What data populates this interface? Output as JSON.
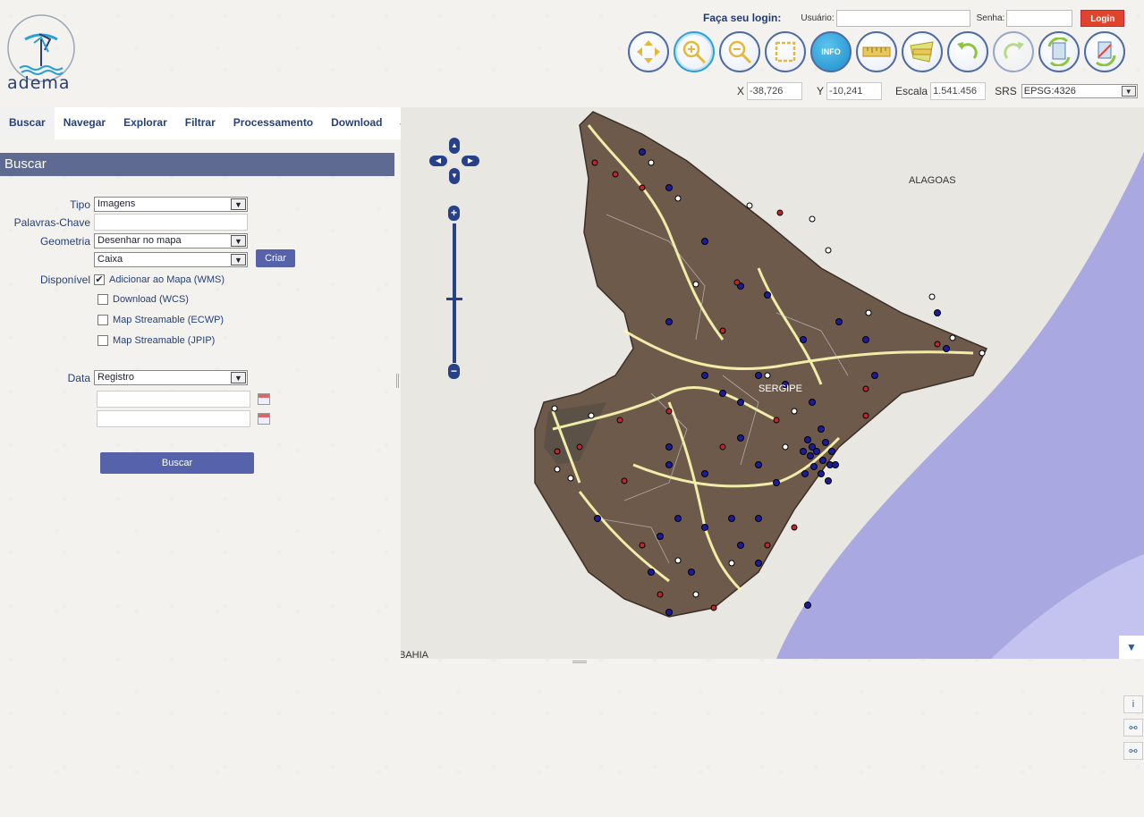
{
  "app": {
    "logo_text": "adema"
  },
  "login": {
    "title": "Faça seu login:",
    "user_label": "Usuário:",
    "password_label": "Senha:",
    "button": "Login"
  },
  "toolbar": {
    "tools": [
      "pan-icon",
      "zoom-in-icon",
      "zoom-out-icon",
      "zoom-box-icon",
      "info-icon",
      "measure-distance-icon",
      "measure-area-icon",
      "undo-icon",
      "redo-icon",
      "refresh-icon",
      "clear-icon"
    ],
    "info_label": "INFO"
  },
  "coords": {
    "x_label": "X",
    "x_value": "-38,726",
    "y_label": "Y",
    "y_value": "-10,241",
    "scale_label": "Escala",
    "scale_value": "1.541.456",
    "srs_label": "SRS",
    "srs_value": "EPSG:4326"
  },
  "tabs": [
    {
      "label": "Buscar"
    },
    {
      "label": "Navegar"
    },
    {
      "label": "Explorar"
    },
    {
      "label": "Filtrar"
    },
    {
      "label": "Processamento"
    },
    {
      "label": "Download"
    }
  ],
  "panel": {
    "title": "Buscar",
    "tipo_label": "Tipo",
    "tipo_value": "Imagens",
    "palavras_label": "Palavras-Chave",
    "geometria_label": "Geometria",
    "geometria_value": "Desenhar no mapa",
    "forma_value": "Caixa",
    "criar_button": "Criar",
    "disponivel_label": "Disponível",
    "options": [
      {
        "label": "Adicionar ao Mapa (WMS)",
        "checked": "✔"
      },
      {
        "label": "Download (WCS)",
        "checked": ""
      },
      {
        "label": "Map Streamable (ECWP)",
        "checked": ""
      },
      {
        "label": "Map Streamable (JPIP)",
        "checked": ""
      }
    ],
    "data_label": "Data",
    "data_value": "Registro",
    "buscar_button": "Buscar"
  },
  "map": {
    "labels": {
      "alagoas": "ALAGOAS",
      "sergipe": "SERGIPE",
      "bahia": "BAHIA"
    }
  }
}
